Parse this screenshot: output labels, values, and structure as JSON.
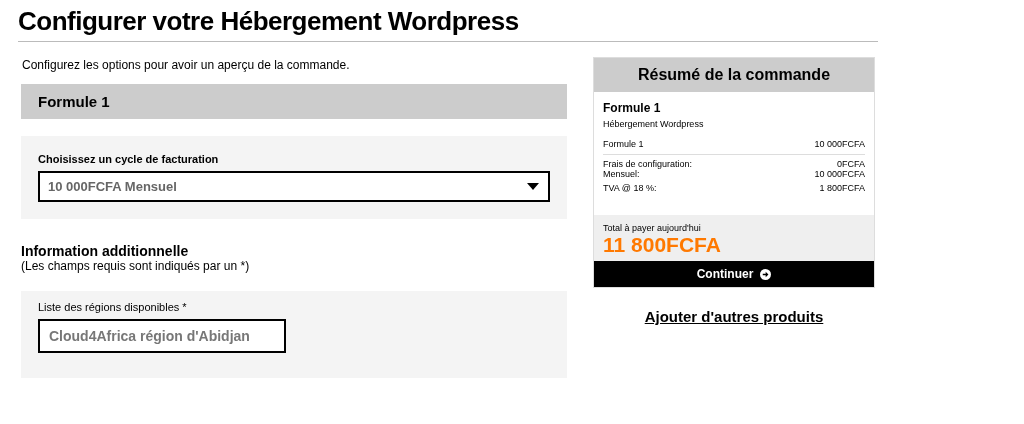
{
  "title": "Configurer votre Hébergement Wordpress",
  "intro": "Configurez les options pour avoir un aperçu de la commande.",
  "product_header": "Formule 1",
  "billing": {
    "label": "Choisissez un cycle de facturation",
    "value": "10 000FCFA Mensuel"
  },
  "additional": {
    "heading": "Information additionnelle",
    "note": "(Les champs requis sont indiqués par un *)"
  },
  "region": {
    "label": "Liste des régions disponibles *",
    "value": "Cloud4Africa région d'Abidjan"
  },
  "summary": {
    "title": "Résumé de la commande",
    "product": "Formule 1",
    "group": "Hébergement Wordpress",
    "line": {
      "label": "Formule 1",
      "amount": "10 000FCFA"
    },
    "fees": [
      {
        "label": "Frais de configuration:",
        "amount": "0FCFA"
      },
      {
        "label": "Mensuel:",
        "amount": "10 000FCFA"
      },
      {
        "label": "TVA @ 18 %:",
        "amount": "1 800FCFA"
      }
    ],
    "total_label": "Total à payer aujourd'hui",
    "total": "11 800FCFA",
    "button": "Continuer"
  },
  "add_more": "Ajouter d'autres produits"
}
